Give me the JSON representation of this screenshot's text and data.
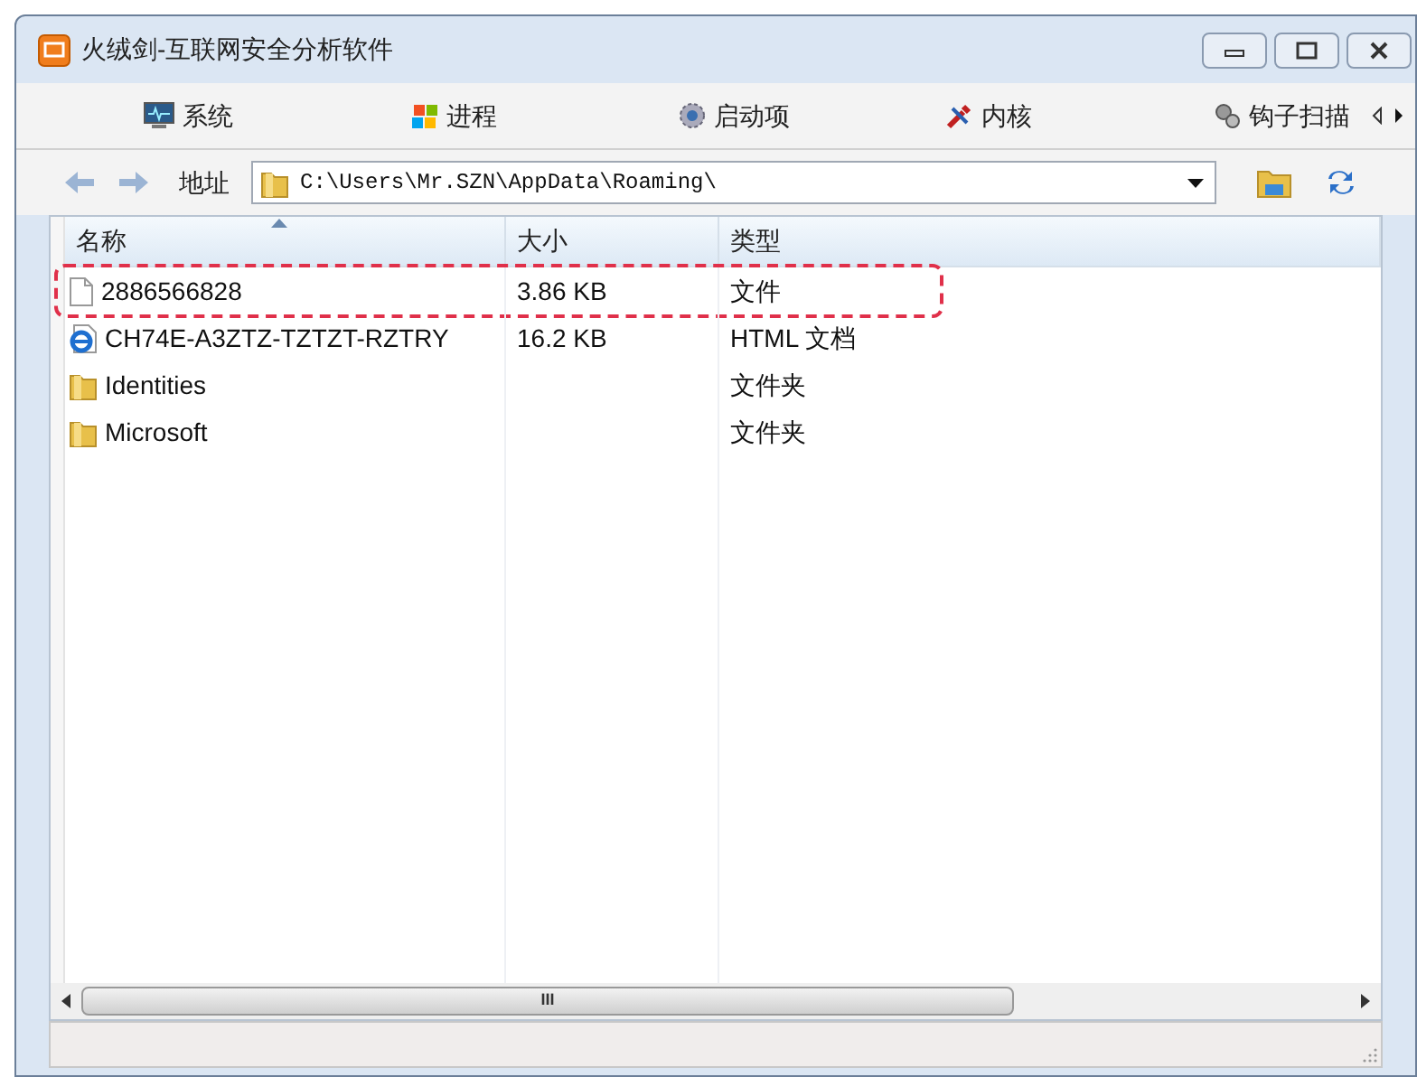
{
  "window": {
    "title": "火绒剑-互联网安全分析软件"
  },
  "tabs": [
    {
      "label": "系统",
      "kind": "monitor"
    },
    {
      "label": "进程",
      "kind": "flag"
    },
    {
      "label": "启动项",
      "kind": "gear"
    },
    {
      "label": "内核",
      "kind": "tool"
    },
    {
      "label": "钩子扫描",
      "kind": "hook"
    }
  ],
  "address": {
    "label": "地址",
    "value": "C:\\Users\\Mr.SZN\\AppData\\Roaming\\"
  },
  "table": {
    "columns": [
      "名称",
      "大小",
      "类型"
    ],
    "rows": [
      {
        "kind": "file",
        "name": "2886566828",
        "size": "3.86 KB",
        "type": "文件",
        "highlighted": true
      },
      {
        "kind": "html",
        "name": "CH74E-A3ZTZ-TZTZT-RZTRY",
        "size": "16.2 KB",
        "type": "HTML 文档",
        "highlighted": false
      },
      {
        "kind": "folder",
        "name": "Identities",
        "type": "文件夹",
        "highlighted": false
      },
      {
        "kind": "folder",
        "name": "Microsoft",
        "type": "文件夹",
        "highlighted": false
      }
    ]
  },
  "scrollbar": {
    "grip": "III"
  }
}
